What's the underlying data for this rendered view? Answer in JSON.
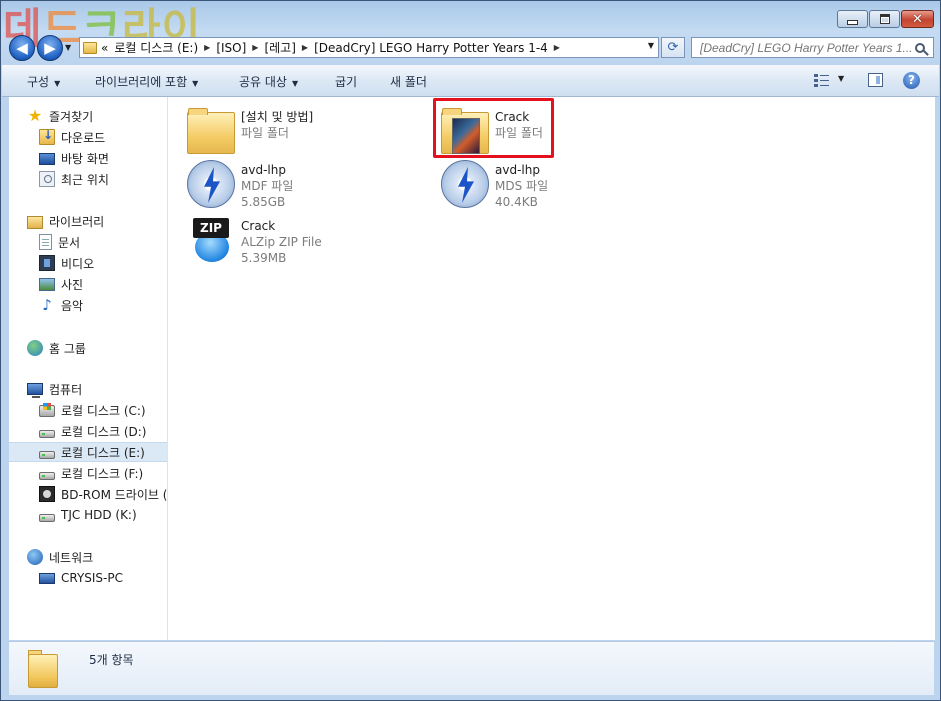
{
  "watermark": {
    "chars": [
      "데",
      "드",
      "크",
      "라",
      "이"
    ]
  },
  "window": {
    "caption": {
      "minimize": "",
      "maximize": "",
      "close": "✕"
    }
  },
  "address_bar": {
    "overflow": "«",
    "crumbs": [
      "로컬 디스크 (E:)",
      "[ISO]",
      "[레고]",
      "[DeadCry] LEGO Harry Potter Years 1-4"
    ]
  },
  "search": {
    "placeholder": "[DeadCry] LEGO Harry Potter Years 1..."
  },
  "toolbar": {
    "organize": "구성",
    "include_library": "라이브러리에 포함",
    "share": "공유 대상",
    "burn": "굽기",
    "new_folder": "새 폴더",
    "help": "?"
  },
  "navpane": {
    "favorites": "즐겨찾기",
    "downloads": "다운로드",
    "desktop": "바탕 화면",
    "recent": "최근 위치",
    "libraries": "라이브러리",
    "documents": "문서",
    "videos": "비디오",
    "pictures": "사진",
    "music": "음악",
    "homegroup": "홈 그룹",
    "computer": "컴퓨터",
    "drive_c": "로컬 디스크 (C:)",
    "drive_d": "로컬 디스크 (D:)",
    "drive_e": "로컬 디스크 (E:)",
    "drive_f": "로컬 디스크 (F:)",
    "bd_rom": "BD-ROM 드라이브 (",
    "tjc": "TJC HDD (K:)",
    "network": "네트워크",
    "crysis_pc": "CRYSIS-PC"
  },
  "files": [
    {
      "name": "[설치 및 방법]",
      "type": "파일 폴더",
      "size": ""
    },
    {
      "name": "Crack",
      "type": "파일 폴더",
      "size": ""
    },
    {
      "name": "avd-lhp",
      "type": "MDF 파일",
      "size": "5.85GB"
    },
    {
      "name": "avd-lhp",
      "type": "MDS 파일",
      "size": "40.4KB"
    },
    {
      "name": "Crack",
      "type": "ALZip ZIP File",
      "size": "5.39MB"
    }
  ],
  "zip_badge": "ZIP",
  "details": {
    "count": "5개 항목"
  },
  "colors": {
    "highlight": "#e4101e",
    "selection": "#dbe8f6",
    "accent": "#1c55c7"
  }
}
